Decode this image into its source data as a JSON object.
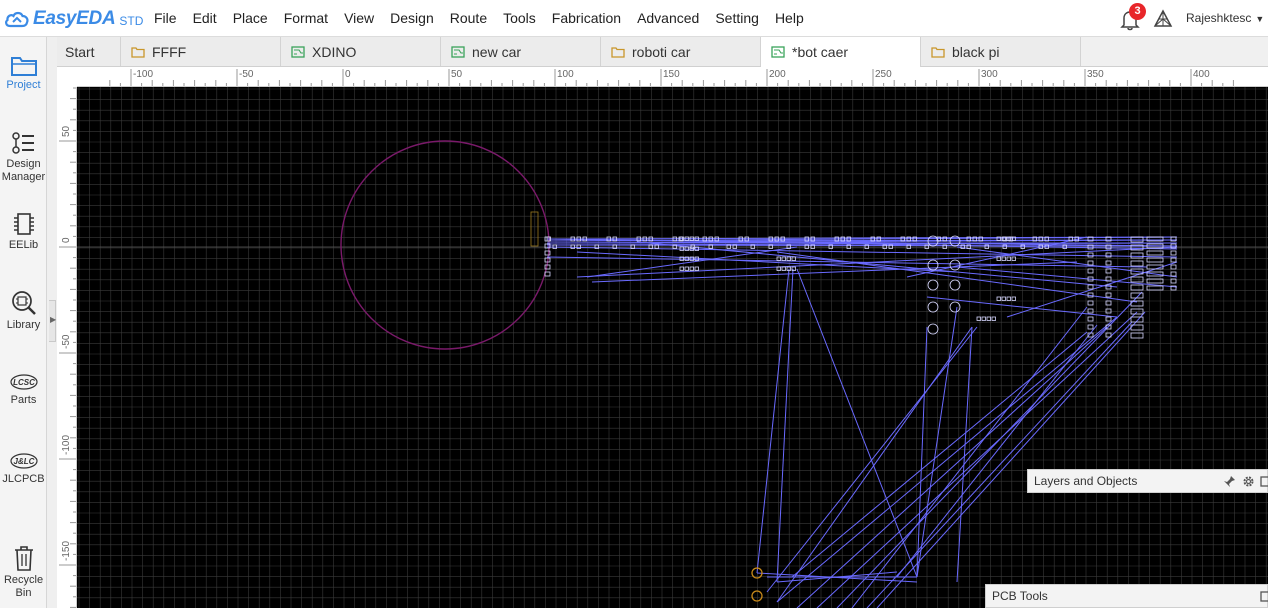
{
  "app": {
    "brand": "EasyEDA",
    "edition": "STD",
    "accent_color": "#3b8be6"
  },
  "menu": [
    "File",
    "Edit",
    "Place",
    "Format",
    "View",
    "Design",
    "Route",
    "Tools",
    "Fabrication",
    "Advanced",
    "Setting",
    "Help"
  ],
  "header": {
    "notification_count": "3",
    "notification_icon": "bell-icon",
    "username": "Rajeshktesc"
  },
  "sidebar": [
    {
      "label": "Project",
      "icon": "folder-icon",
      "active": true
    },
    {
      "label": "Design Manager",
      "icon": "tree-icon",
      "active": false
    },
    {
      "label": "EELib",
      "icon": "chip-icon",
      "active": false
    },
    {
      "label": "Library",
      "icon": "library-search-icon",
      "active": false
    },
    {
      "label": "Parts",
      "icon": "lcsc-icon",
      "active": false
    },
    {
      "label": "JLCPCB",
      "icon": "jlc-icon",
      "active": false
    },
    {
      "label": "Recycle Bin",
      "icon": "trash-icon",
      "active": false
    }
  ],
  "tabs": [
    {
      "label": "Start",
      "icon": "none",
      "active": false
    },
    {
      "label": "FFFF",
      "icon": "folder-icon",
      "active": false
    },
    {
      "label": "XDINO",
      "icon": "pcb-icon",
      "active": false
    },
    {
      "label": "new car",
      "icon": "pcb-icon",
      "active": false
    },
    {
      "label": "roboti car",
      "icon": "folder-icon",
      "active": false
    },
    {
      "label": "*bot caer",
      "icon": "pcb-icon",
      "active": true
    },
    {
      "label": "black pi",
      "icon": "folder-icon",
      "active": false
    }
  ],
  "ruler": {
    "x_labels": [
      "-100",
      "-50",
      "0",
      "50",
      "100",
      "150",
      "200",
      "250",
      "300",
      "350",
      "400"
    ],
    "y_labels": [
      "50",
      "0",
      "-50",
      "-100",
      "-150"
    ]
  },
  "panels": {
    "layers_title": "Layers and Objects",
    "pcb_tools_title": "PCB Tools"
  },
  "colors": {
    "canvas_bg": "#000000",
    "grid": "#3a3a3a",
    "ratsnest": "#6a6aff",
    "board_circle": "#7a1a6a",
    "badge": "#e8262a"
  }
}
